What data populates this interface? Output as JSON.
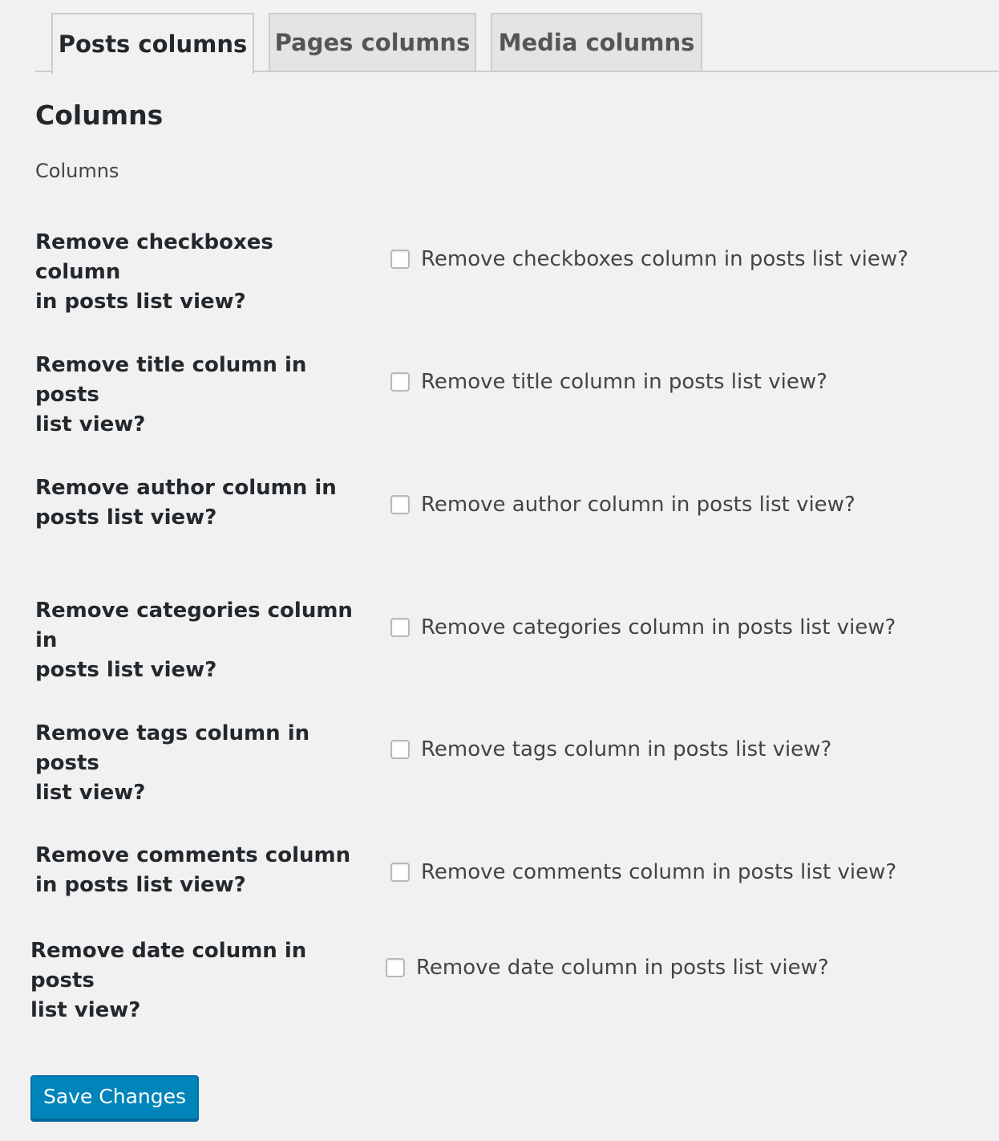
{
  "tabs": [
    {
      "label": "Posts columns",
      "active": true
    },
    {
      "label": "Pages columns",
      "active": false
    },
    {
      "label": "Media columns",
      "active": false
    }
  ],
  "section": {
    "title": "Columns",
    "description": "Columns"
  },
  "rows": [
    {
      "label_line1": "Remove checkboxes column",
      "label_line2": "in posts list view?",
      "checkbox_label": "Remove checkboxes column in posts list view?",
      "checked": false
    },
    {
      "label_line1": "Remove title column in posts",
      "label_line2": "list view?",
      "checkbox_label": "Remove title column in posts list view?",
      "checked": false
    },
    {
      "label_line1": "Remove author column in",
      "label_line2": "posts list view?",
      "checkbox_label": "Remove author column in posts list view?",
      "checked": false
    },
    {
      "label_line1": "Remove categories column in",
      "label_line2": "posts list view?",
      "checkbox_label": "Remove categories column in posts list view?",
      "checked": false
    },
    {
      "label_line1": "Remove tags column in posts",
      "label_line2": "list view?",
      "checkbox_label": "Remove tags column in posts list view?",
      "checked": false
    },
    {
      "label_line1": "Remove comments column",
      "label_line2": "in posts list view?",
      "checkbox_label": "Remove comments column in posts list view?",
      "checked": false
    },
    {
      "label_line1": "Remove date column in posts",
      "label_line2": "list view?",
      "checkbox_label": "Remove date column in posts list view?",
      "checked": false
    }
  ],
  "save_button": {
    "label": "Save Changes"
  },
  "colors": {
    "primary_button": "#0085ba",
    "background": "#f1f1f1"
  }
}
